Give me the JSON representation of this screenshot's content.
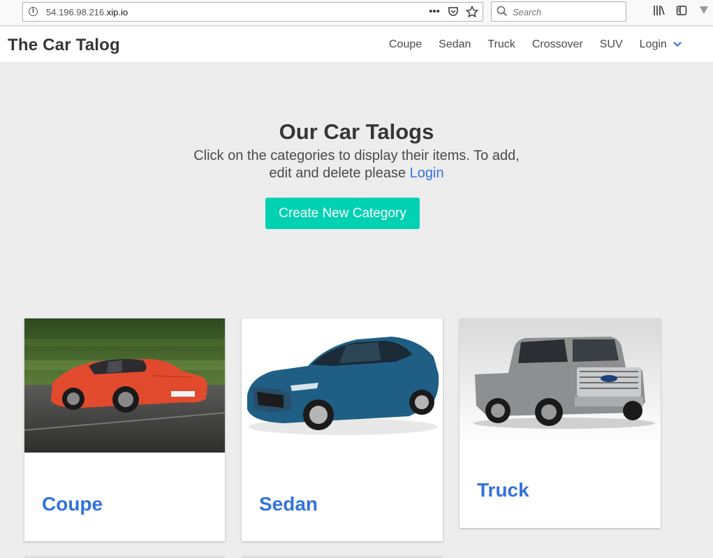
{
  "browser": {
    "url_prefix": "54.196.98.216.",
    "url_domain": "xip.io",
    "search_placeholder": "Search"
  },
  "navbar": {
    "brand": "The Car Talog",
    "items": [
      "Coupe",
      "Sedan",
      "Truck",
      "Crossover",
      "SUV"
    ],
    "login": "Login"
  },
  "hero": {
    "title": "Our Car Talogs",
    "subtitle_line1": "Click on the categories to display their items. To add,",
    "subtitle_line2_pre": "edit and delete please ",
    "subtitle_link": "Login",
    "create_button": "Create New Category"
  },
  "cards": [
    {
      "title": "Coupe"
    },
    {
      "title": "Sedan"
    },
    {
      "title": "Truck"
    }
  ],
  "colors": {
    "accent": "#00d1b2",
    "link": "#3273dc",
    "background": "#ededed"
  }
}
